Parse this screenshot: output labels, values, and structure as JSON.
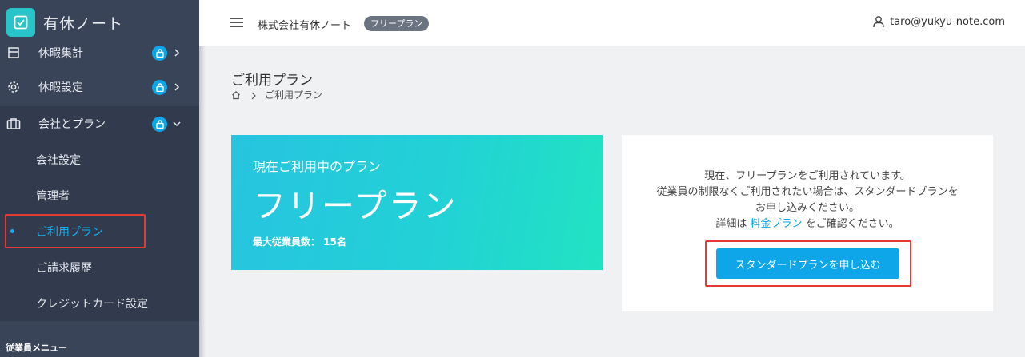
{
  "app": {
    "name": "有休ノート",
    "accent": "#0ea5e9",
    "sidebar_bg": "#3a4458"
  },
  "sidebar": {
    "items": [
      {
        "label": "休暇集計",
        "icon": "table-icon",
        "locked": true
      },
      {
        "label": "休暇設定",
        "icon": "gear-icon",
        "locked": true
      },
      {
        "label": "会社とプラン",
        "icon": "briefcase-icon",
        "locked": true,
        "expanded": true
      }
    ],
    "subitems": [
      {
        "label": "会社設定"
      },
      {
        "label": "管理者"
      },
      {
        "label": "ご利用プラン",
        "current": true
      },
      {
        "label": "ご請求履歴"
      },
      {
        "label": "クレジットカード設定"
      }
    ],
    "section_title": "従業員メニュー"
  },
  "header": {
    "company": "株式会社有休ノート",
    "plan_badge": "フリープラン",
    "user_email": "taro@yukyu-note.com"
  },
  "page": {
    "title": "ご利用プラン",
    "breadcrumb": [
      "ご利用プラン"
    ]
  },
  "plan_card": {
    "subtitle": "現在ご利用中のプラン",
    "plan_name": "フリープラン",
    "max_employees": "最大従業員数： 15名"
  },
  "info_card": {
    "line1": "現在、フリープランをご利用されています。",
    "line2": "従業員の制限なくご利用されたい場合は、スタンダードプランを",
    "line3": "お申し込みください。",
    "line4_prefix": "詳細は ",
    "line4_link": "料金プラン",
    "line4_suffix": " をご確認ください。",
    "cta": "スタンダードプランを申し込む"
  }
}
